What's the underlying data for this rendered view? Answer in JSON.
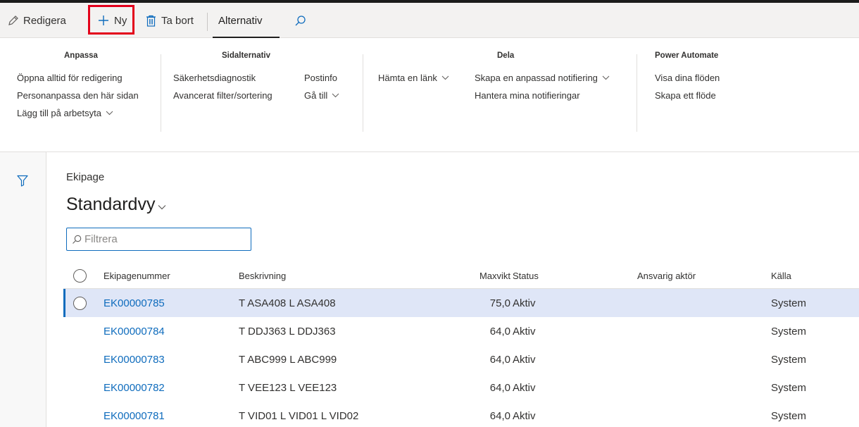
{
  "actionbar": {
    "edit_label": "Redigera",
    "new_label": "Ny",
    "delete_label": "Ta bort",
    "options_tab": "Alternativ"
  },
  "ribbon": {
    "groups": {
      "customize": {
        "title": "Anpassa",
        "items": [
          "Öppna alltid för redigering",
          "Personanpassa den här sidan",
          "Lägg till på arbetsyta"
        ]
      },
      "page_options": {
        "title": "Sidalternativ",
        "items": [
          "Säkerhetsdiagnostik",
          "Avancerat filter/sortering",
          "Postinfo",
          "Gå till"
        ]
      },
      "share": {
        "title": "Dela",
        "items": [
          "Hämta en länk",
          "Skapa en anpassad notifiering",
          "Hantera mina notifieringar"
        ]
      },
      "power_automate": {
        "title": "Power Automate",
        "items": [
          "Visa dina flöden",
          "Skapa ett flöde"
        ]
      }
    }
  },
  "page": {
    "caption": "Ekipage",
    "view_name": "Standardvy",
    "filter_placeholder": "Filtrera"
  },
  "grid": {
    "columns": [
      "Ekipagenummer",
      "Beskrivning",
      "Maxvikt",
      "Status",
      "Ansvarig aktör",
      "Källa"
    ],
    "rows": [
      {
        "number": "EK00000785",
        "description": "T ASA408 L ASA408",
        "maxweight": "75,0",
        "status": "Aktiv",
        "responsible": "",
        "source": "System",
        "selected": true
      },
      {
        "number": "EK00000784",
        "description": "T DDJ363 L DDJ363",
        "maxweight": "64,0",
        "status": "Aktiv",
        "responsible": "",
        "source": "System",
        "selected": false
      },
      {
        "number": "EK00000783",
        "description": "T ABC999 L ABC999",
        "maxweight": "64,0",
        "status": "Aktiv",
        "responsible": "",
        "source": "System",
        "selected": false
      },
      {
        "number": "EK00000782",
        "description": "T VEE123 L VEE123",
        "maxweight": "64,0",
        "status": "Aktiv",
        "responsible": "",
        "source": "System",
        "selected": false
      },
      {
        "number": "EK00000781",
        "description": "T VID01 L VID01 L VID02",
        "maxweight": "64,0",
        "status": "Aktiv",
        "responsible": "",
        "source": "System",
        "selected": false
      }
    ]
  },
  "colors": {
    "accent": "#0f6cbd",
    "highlight": "#e3001b",
    "selected_row": "#dfe6f7"
  }
}
